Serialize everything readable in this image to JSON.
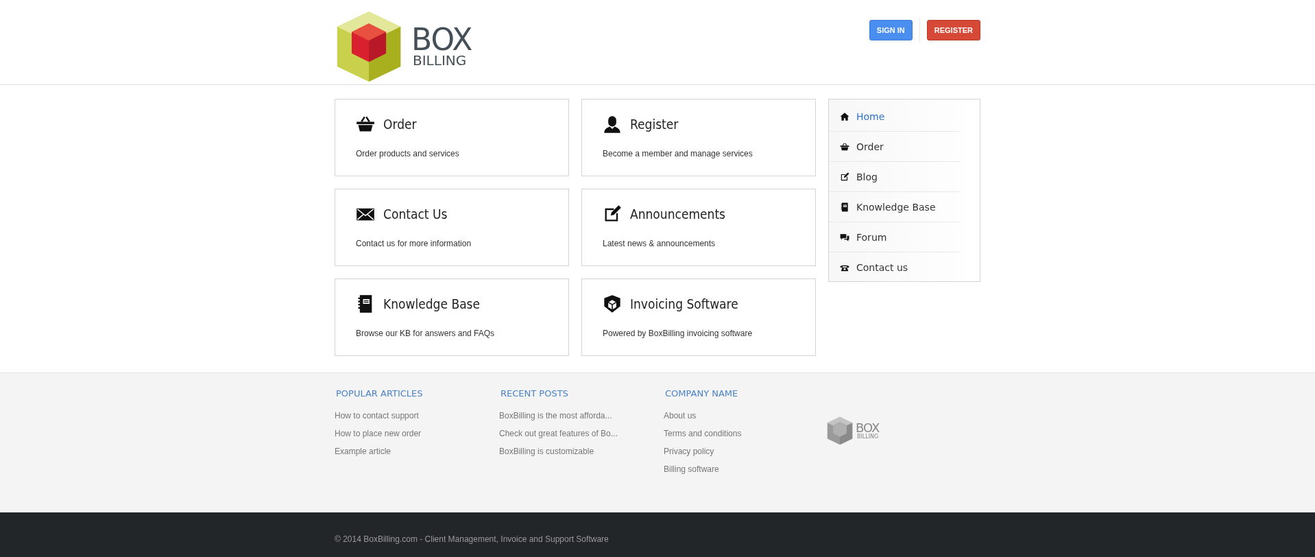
{
  "header": {
    "logo": {
      "line_1": "BOX",
      "line_2": "BILLING"
    },
    "buttons": [
      {
        "label": "SIGN IN",
        "kind": "primary"
      },
      {
        "label": "REGISTER",
        "kind": "danger"
      }
    ]
  },
  "cards": [
    {
      "title": "Order",
      "description": "Order products and services"
    },
    {
      "title": "Register",
      "description": "Become a member and manage services"
    },
    {
      "title": "Contact Us",
      "description": "Contact us for more information"
    },
    {
      "title": "Announcements",
      "description": "Latest news & announcements"
    },
    {
      "title": "Knowledge Base",
      "description": "Browse our KB for answers and FAQs"
    },
    {
      "title": "Invoicing Software",
      "description": "Powered by BoxBilling invoicing software"
    }
  ],
  "sidebar": {
    "items": [
      {
        "label": "Home",
        "selected": true
      },
      {
        "label": "Order",
        "selected": false
      },
      {
        "label": "Blog",
        "selected": false
      },
      {
        "label": "Knowledge Base",
        "selected": false
      },
      {
        "label": "Forum",
        "selected": false
      },
      {
        "label": "Contact us",
        "selected": false
      }
    ]
  },
  "footer": {
    "columns": [
      {
        "heading": "POPULAR ARTICLES",
        "links": [
          "How to contact support",
          "How to place new order",
          "Example article"
        ]
      },
      {
        "heading": "RECENT POSTS",
        "links": [
          "BoxBilling is the most afforda...",
          "Check out great features of Bo...",
          "BoxBilling is customizable"
        ]
      },
      {
        "heading": "COMPANY NAME",
        "links": [
          "About us",
          "Terms and conditions",
          "Privacy policy",
          "Billing software"
        ]
      }
    ],
    "logo": {
      "line_1": "BOX",
      "line_2": "BILLING"
    },
    "copyright": "© 2014 BoxBilling.com - Client Management, Invoice and Support Software"
  }
}
